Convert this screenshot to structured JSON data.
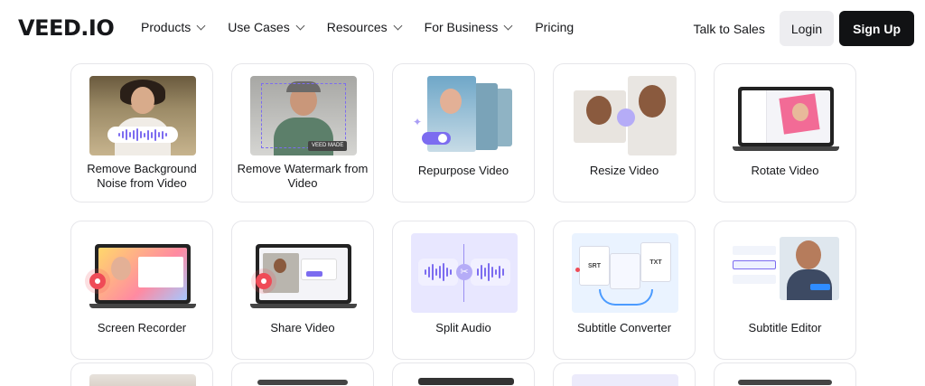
{
  "nav": {
    "logo": "VEED.IO",
    "items": [
      {
        "label": "Products",
        "dropdown": true
      },
      {
        "label": "Use Cases",
        "dropdown": true
      },
      {
        "label": "Resources",
        "dropdown": true
      },
      {
        "label": "For Business",
        "dropdown": true
      },
      {
        "label": "Pricing",
        "dropdown": false
      }
    ],
    "talk_to_sales": "Talk to Sales",
    "login": "Login",
    "signup": "Sign Up"
  },
  "tools": [
    {
      "label": "Remove Background Noise from Video"
    },
    {
      "label": "Remove Watermark from Video"
    },
    {
      "label": "Repurpose Video"
    },
    {
      "label": "Resize Video"
    },
    {
      "label": "Rotate Video"
    },
    {
      "label": "Screen Recorder"
    },
    {
      "label": "Share Video"
    },
    {
      "label": "Split Audio"
    },
    {
      "label": "Subtitle Converter"
    },
    {
      "label": "Subtitle Editor"
    }
  ],
  "thumb_text": {
    "watermark_badge": "VEED MADE",
    "srt": "SRT",
    "txt": "TXT"
  },
  "colors": {
    "accent": "#7c6cf0",
    "record_red": "#ef4b57",
    "signup_bg": "#111214",
    "login_bg": "#ededf0"
  }
}
